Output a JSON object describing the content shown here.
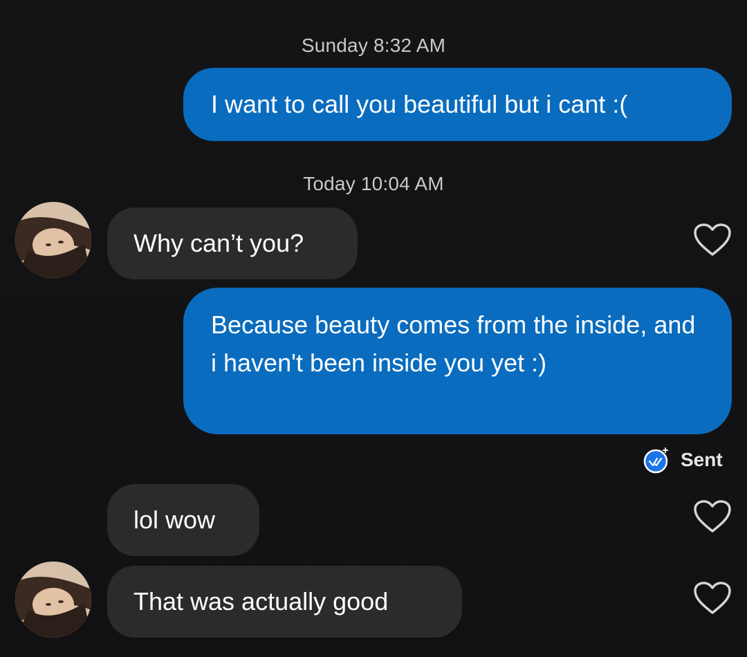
{
  "conversation": {
    "timestamps": [
      "Sunday 8:32 AM",
      "Today 10:04 AM"
    ],
    "messages": [
      {
        "direction": "outgoing",
        "text": "I want to call you beautiful but i cant :("
      },
      {
        "direction": "incoming",
        "text": "Why can’t you?"
      },
      {
        "direction": "outgoing",
        "text": "Because beauty comes from the inside, and i haven't been inside you yet :)"
      },
      {
        "direction": "incoming",
        "text": "lol wow"
      },
      {
        "direction": "incoming",
        "text": "That was actually good"
      }
    ],
    "status": {
      "label": "Sent",
      "icon": "sent-check-icon"
    },
    "like_icon": "heart-outline-icon"
  },
  "colors": {
    "background": "#121214",
    "outgoing_bubble": "#0a6cbe",
    "incoming_bubble": "#2b2b2e",
    "status_accent": "#1c74e8"
  }
}
